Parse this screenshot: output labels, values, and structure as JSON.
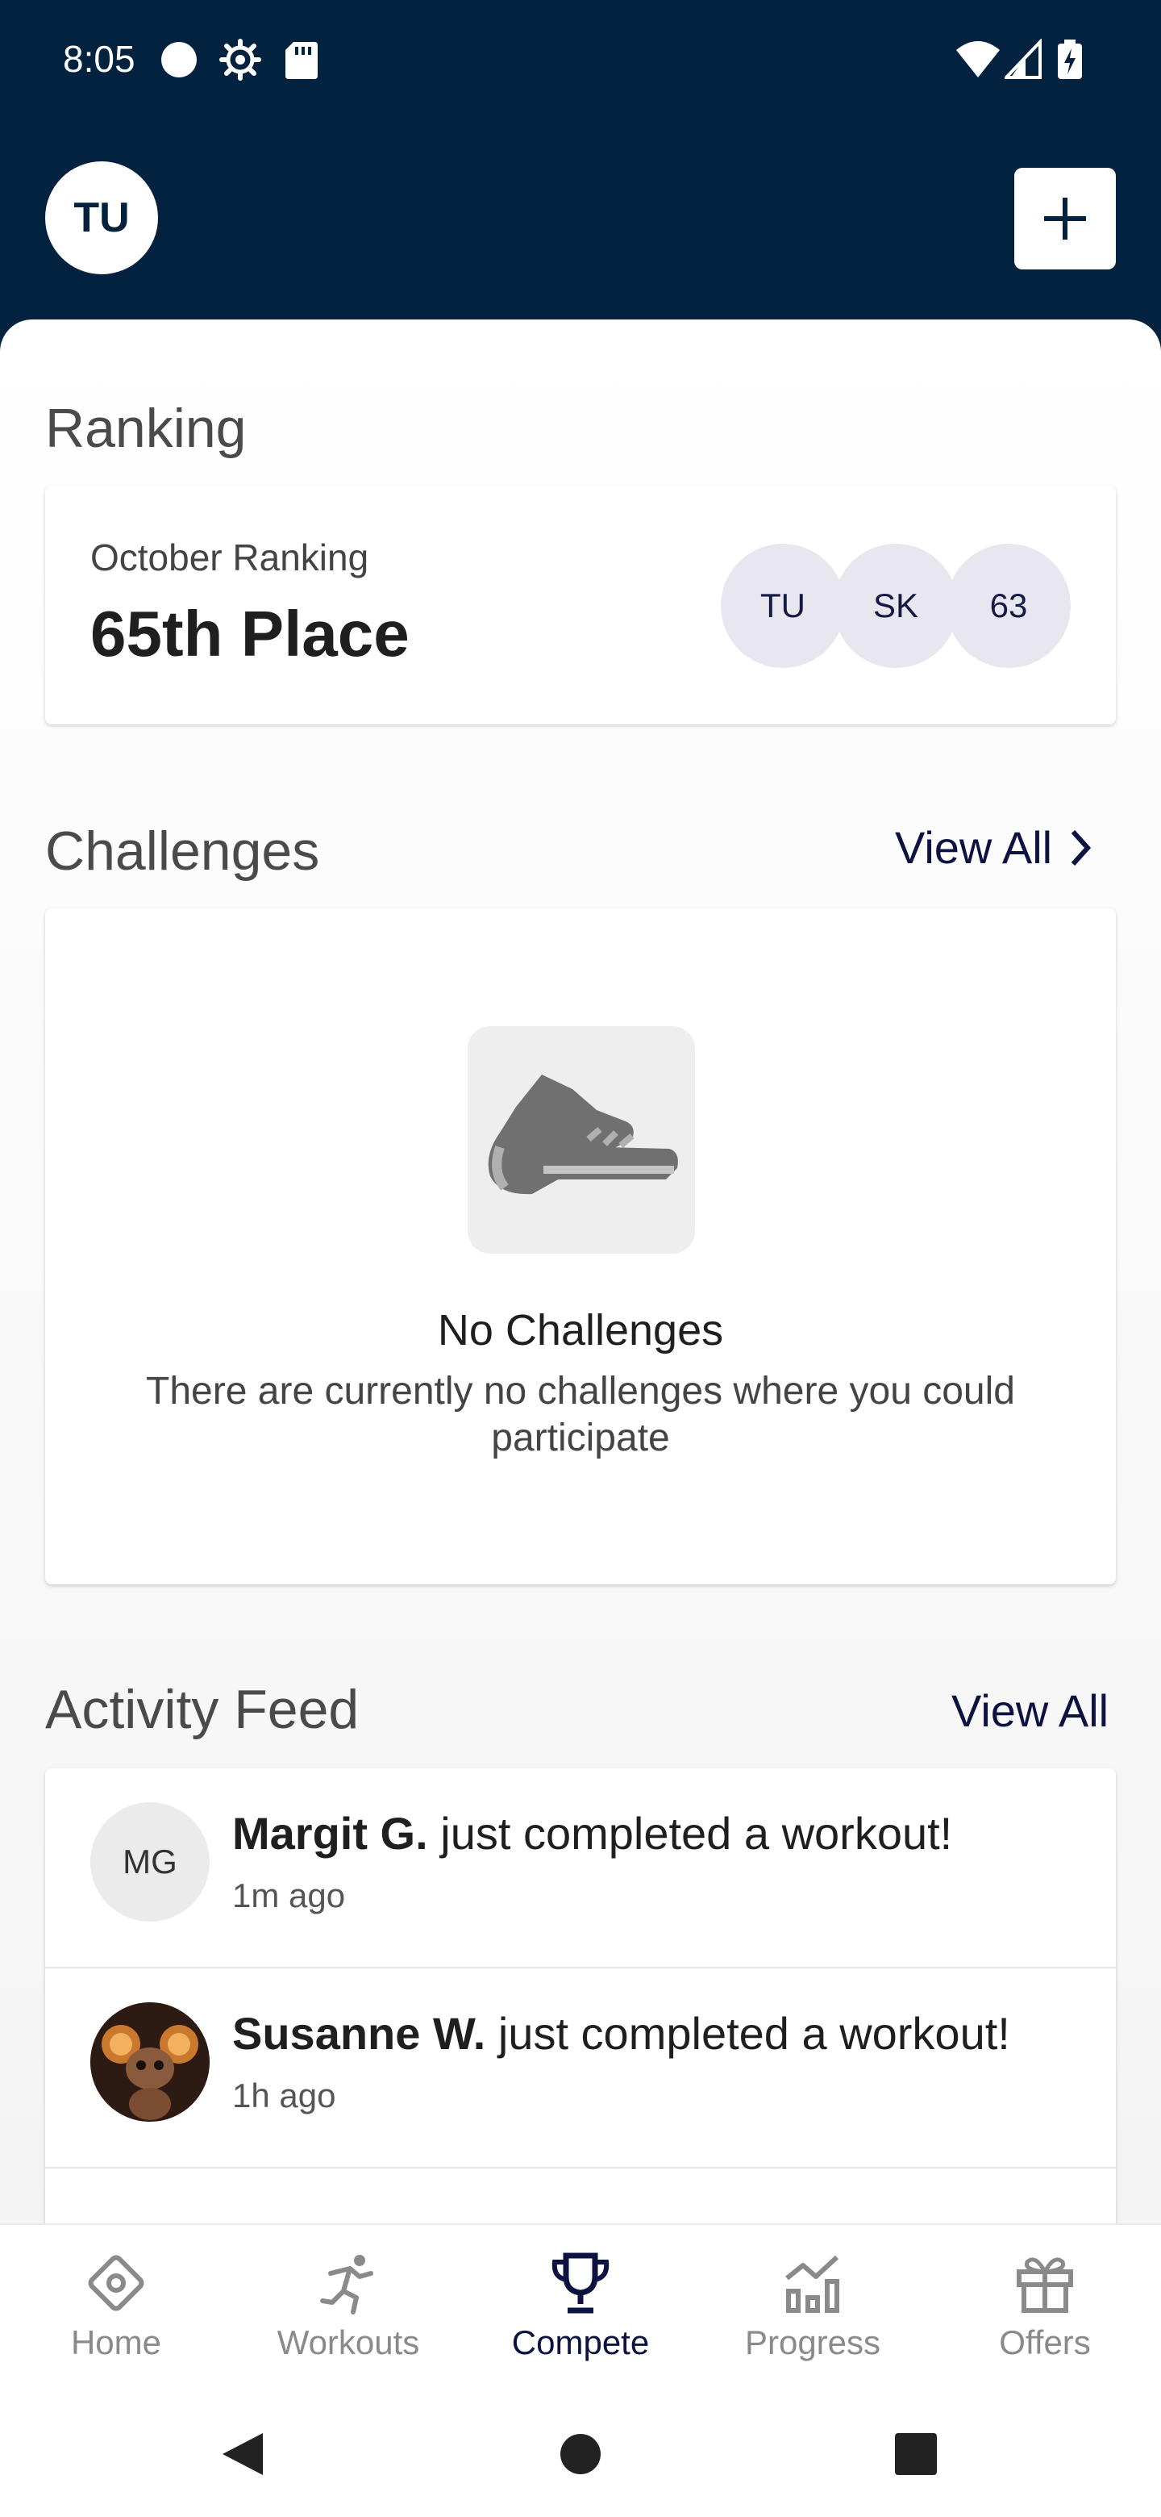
{
  "status_bar": {
    "time": "8:05"
  },
  "header": {
    "user_initials": "TU"
  },
  "ranking": {
    "title": "Ranking",
    "subtitle": "October Ranking",
    "place": "65th Place",
    "avatars": [
      "TU",
      "SK",
      "63"
    ]
  },
  "challenges": {
    "title": "Challenges",
    "view_all": "View All",
    "empty_title": "No Challenges",
    "empty_text": "There are currently no challenges where you could participate"
  },
  "activity_feed": {
    "title": "Activity Feed",
    "view_all": "View All",
    "items": [
      {
        "initials": "MG",
        "name": "Margit G.",
        "action": " just completed a workout!",
        "time": "1m ago"
      },
      {
        "initials": "",
        "name": "Susanne W.",
        "action": " just completed a workout!",
        "time": "1h ago"
      }
    ]
  },
  "nav": {
    "items": [
      {
        "label": "Home",
        "icon": "home-icon"
      },
      {
        "label": "Workouts",
        "icon": "running-icon"
      },
      {
        "label": "Compete",
        "icon": "trophy-icon"
      },
      {
        "label": "Progress",
        "icon": "chart-icon"
      },
      {
        "label": "Offers",
        "icon": "gift-icon"
      }
    ],
    "active": "Compete"
  },
  "colors": {
    "header": "#032240",
    "accent": "#0d1340",
    "inactive": "#8a8a8a"
  }
}
